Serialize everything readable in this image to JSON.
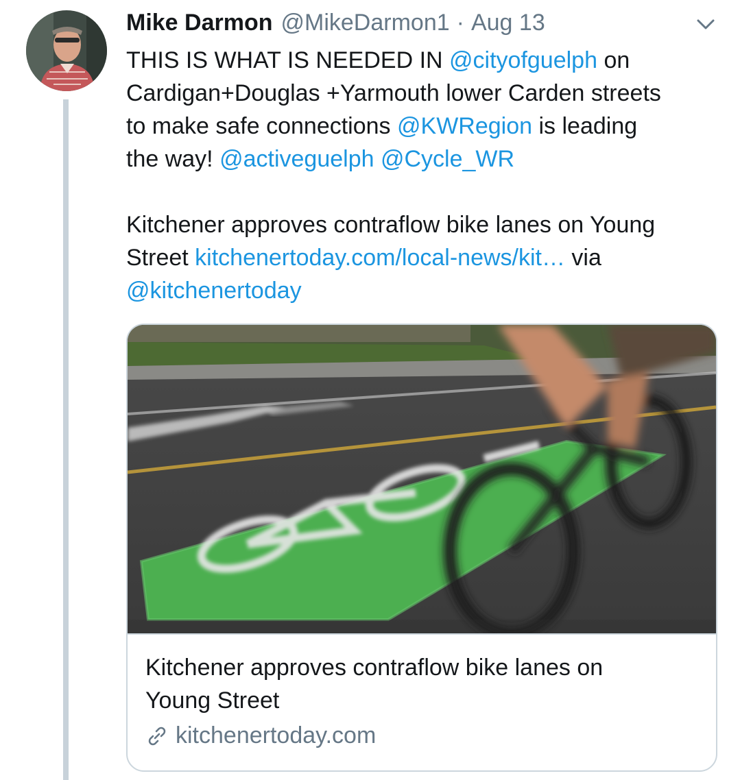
{
  "tweet": {
    "display_name": "Mike Darmon",
    "handle": "@MikeDarmon1",
    "separator": "·",
    "date": "Aug 13",
    "menu_icon": "chevron-down-icon",
    "avatar_icon": "avatar-photo",
    "text": {
      "l1_a": "THIS  IS WHAT IS NEEDED IN ",
      "l1_link": "@cityofguelph",
      "l1_b": " on",
      "l2": "Cardigan+Douglas +Yarmouth lower Carden streets",
      "l3_a": "to make safe connections  ",
      "l3_link": "@KWRegion",
      "l3_b": " is leading",
      "l4_a": "the way! ",
      "l4_link1": "@activeguelph",
      "l4_space": " ",
      "l4_link2": "@Cycle_WR",
      "l5": "Kitchener approves contraflow bike lanes on Young",
      "l6_a": "Street ",
      "l6_link": "kitchenertoday.com/local-news/kit…",
      "l6_b": " via",
      "l7_link": "@kitchenertoday"
    }
  },
  "card": {
    "title_line1": "Kitchener approves contraflow bike lanes on",
    "title_line2": "Young Street",
    "domain": "kitchenertoday.com",
    "link_icon": "link-icon"
  },
  "colors": {
    "text": "#14171a",
    "secondary": "#657786",
    "link": "#1b95e0",
    "border": "#ccd6dd",
    "thread_line": "#c8d2da",
    "bike_lane_green": "#4caf50"
  }
}
